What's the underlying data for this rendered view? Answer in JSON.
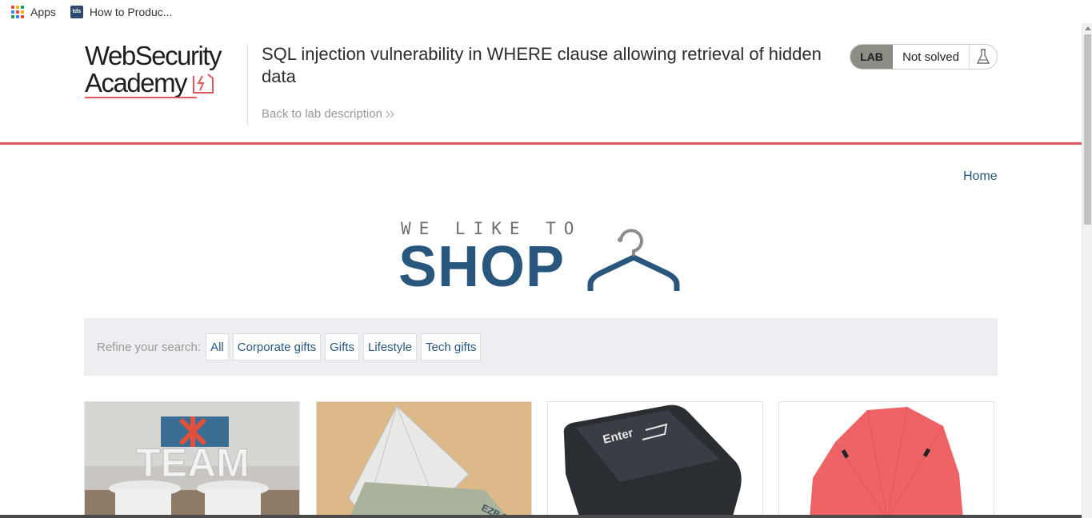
{
  "bookmarks": {
    "apps_label": "Apps",
    "tab2_label": "How to Produc...",
    "tab2_favicon": "tds"
  },
  "header": {
    "logo_line1": "WebSecurity",
    "logo_line2": "Academy",
    "lab_title": "SQL injection vulnerability in WHERE clause allowing retrieval of hidden data",
    "back_link": "Back to lab description",
    "lab_badge": "LAB",
    "lab_state": "Not solved",
    "accent_color": "#e0585f"
  },
  "nav": {
    "home": "Home"
  },
  "shop_logo": {
    "tagline": "WE LIKE TO",
    "word": "SHOP"
  },
  "filters": {
    "label": "Refine your search:",
    "categories": [
      "All",
      "Corporate gifts",
      "Gifts",
      "Lifestyle",
      "Tech gifts"
    ]
  },
  "products": [
    {
      "image": "team-sign-image"
    },
    {
      "image": "origami-note-image"
    },
    {
      "image": "enter-key-image"
    },
    {
      "image": "red-umbrella-image"
    }
  ],
  "product_overlay_text": {
    "team": "TEAM",
    "enter": "Enter",
    "banknote": "EZB EKT"
  },
  "brand_color": "#29567c"
}
